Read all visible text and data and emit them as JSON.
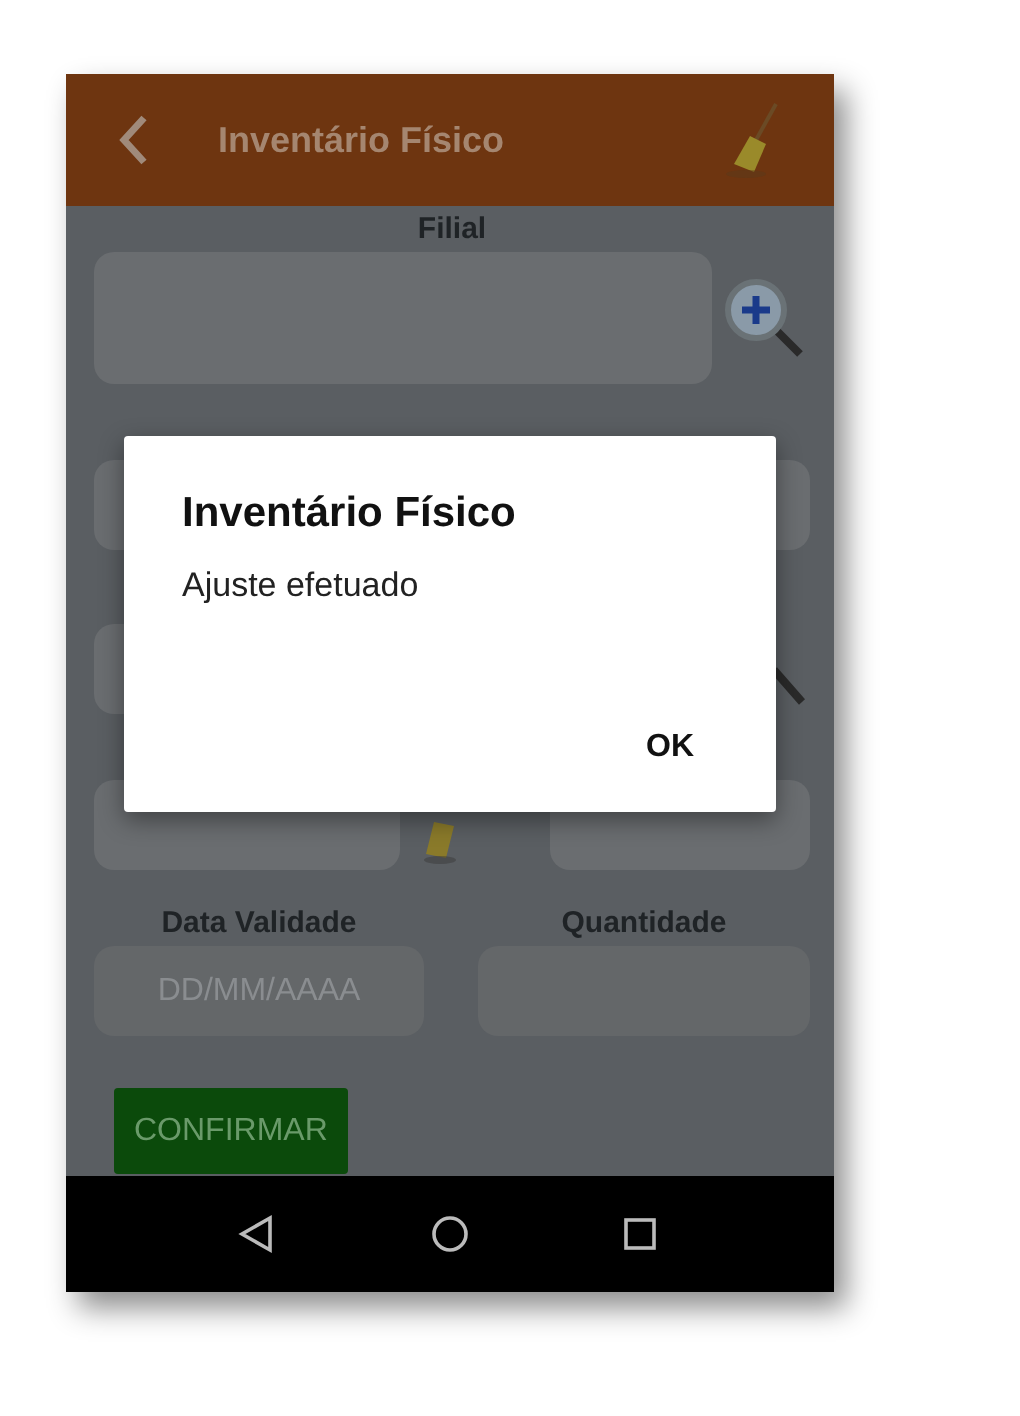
{
  "app_bar": {
    "title": "Inventário Físico"
  },
  "form": {
    "filial_label": "Filial",
    "data_validade": {
      "label": "Data Validade",
      "placeholder": "DD/MM/AAAA"
    },
    "quantidade": {
      "label": "Quantidade"
    },
    "confirm_button": "CONFIRMAR"
  },
  "dialog": {
    "title": "Inventário Físico",
    "message": "Ajuste efetuado",
    "buttons": [
      "OK"
    ]
  }
}
